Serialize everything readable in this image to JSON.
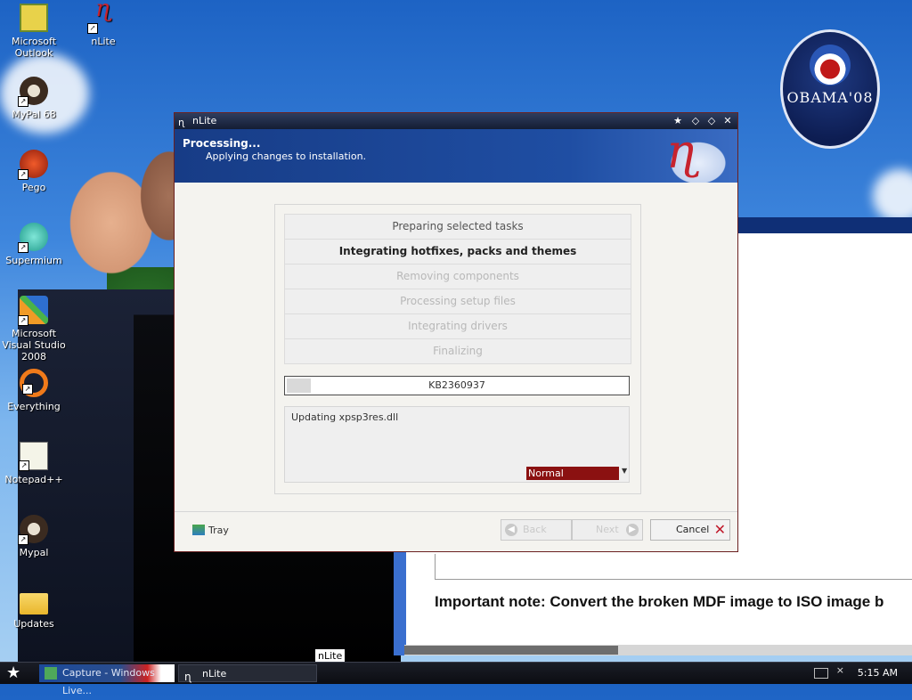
{
  "desktop": {
    "icons": [
      {
        "label": "Microsoft Outlook",
        "icon": "outlook-icon",
        "shortcut": false
      },
      {
        "label": "nLite",
        "icon": "nlite-icon",
        "shortcut": true
      },
      {
        "label": "MyPal 68",
        "icon": "mypal-icon",
        "shortcut": true
      },
      {
        "label": "Pego",
        "icon": "pego-icon",
        "shortcut": true
      },
      {
        "label": "Supermium",
        "icon": "supermium-icon",
        "shortcut": true
      },
      {
        "label": "Microsoft Visual Studio 2008",
        "icon": "visual-studio-icon",
        "shortcut": true
      },
      {
        "label": "Everything",
        "icon": "everything-icon",
        "shortcut": true
      },
      {
        "label": "Notepad++",
        "icon": "notepadpp-icon",
        "shortcut": true
      },
      {
        "label": "Mypal",
        "icon": "mypal-icon",
        "shortcut": true
      },
      {
        "label": "Updates",
        "icon": "folder-icon",
        "shortcut": false
      }
    ],
    "badge_text": "OBAMA'08"
  },
  "browser": {
    "note": "Important note: Convert the broken MDF image to ISO image b"
  },
  "nlite": {
    "title": "nLite",
    "header": "Processing...",
    "subheader": "Applying changes to installation.",
    "tasks": [
      {
        "label": "Preparing selected tasks",
        "state": "done"
      },
      {
        "label": "Integrating hotfixes, packs and themes",
        "state": "active"
      },
      {
        "label": "Removing components",
        "state": "pending"
      },
      {
        "label": "Processing setup files",
        "state": "pending"
      },
      {
        "label": "Integrating drivers",
        "state": "pending"
      },
      {
        "label": "Finalizing",
        "state": "pending"
      }
    ],
    "progress": {
      "label": "KB2360937",
      "fraction": 0.07
    },
    "log_text": "Updating xpsp3res.dll",
    "priority": {
      "selected": "Normal"
    },
    "footer": {
      "tray": "Tray",
      "back": "Back",
      "next": "Next",
      "cancel": "Cancel"
    }
  },
  "tooltip": "nLite",
  "taskbar": {
    "items": [
      {
        "label": "Capture - Windows Live..."
      },
      {
        "label": "nLite"
      }
    ],
    "clock": "5:15 AM"
  },
  "colors": {
    "titlebar": "#1b2541",
    "banner": "#1f4ea3",
    "priority_bg": "#8b1111",
    "cancel_x": "#c0192b"
  }
}
